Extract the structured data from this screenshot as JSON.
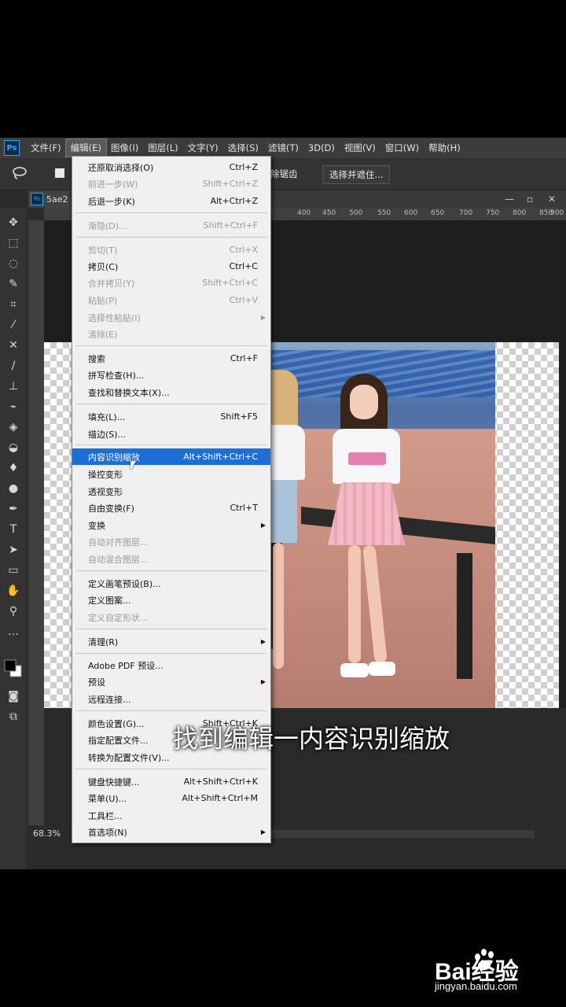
{
  "menubar": {
    "logo": "Ps",
    "items": [
      "文件(F)",
      "编辑(E)",
      "图像(I)",
      "图层(L)",
      "文字(Y)",
      "选择(S)",
      "滤镜(T)",
      "3D(D)",
      "视图(V)",
      "窗口(W)",
      "帮助(H)"
    ]
  },
  "options": {
    "remove_label": "除锯齿",
    "select_mask_label": "选择并遮住..."
  },
  "doc": {
    "tab_label": "5ae2",
    "tab_logo": "Ps",
    "zoom": "68.3%",
    "ruler_ticks": [
      "400",
      "450",
      "500",
      "550",
      "600",
      "650",
      "700",
      "750",
      "800",
      "850",
      "900"
    ]
  },
  "edit_menu": [
    {
      "label": "还原取消选择(O)",
      "shortcut": "Ctrl+Z",
      "disabled": false
    },
    {
      "label": "前进一步(W)",
      "shortcut": "Shift+Ctrl+Z",
      "disabled": true
    },
    {
      "label": "后退一步(K)",
      "shortcut": "Alt+Ctrl+Z",
      "disabled": false
    },
    {
      "label": "渐隐(D)...",
      "shortcut": "Shift+Ctrl+F",
      "disabled": true
    },
    {
      "label": "剪切(T)",
      "shortcut": "Ctrl+X",
      "disabled": true
    },
    {
      "label": "拷贝(C)",
      "shortcut": "Ctrl+C",
      "disabled": false
    },
    {
      "label": "合并拷贝(Y)",
      "shortcut": "Shift+Ctrl+C",
      "disabled": true
    },
    {
      "label": "粘贴(P)",
      "shortcut": "Ctrl+V",
      "disabled": true
    },
    {
      "label": "选择性粘贴(I)",
      "shortcut": "",
      "disabled": true
    },
    {
      "label": "清除(E)",
      "shortcut": "",
      "disabled": true
    },
    {
      "label": "搜索",
      "shortcut": "Ctrl+F",
      "disabled": false
    },
    {
      "label": "拼写检查(H)...",
      "shortcut": "",
      "disabled": false
    },
    {
      "label": "查找和替换文本(X)...",
      "shortcut": "",
      "disabled": false
    },
    {
      "label": "填充(L)...",
      "shortcut": "Shift+F5",
      "disabled": false
    },
    {
      "label": "描边(S)...",
      "shortcut": "",
      "disabled": false
    },
    {
      "label": "内容识别缩放",
      "shortcut": "Alt+Shift+Ctrl+C",
      "disabled": false
    },
    {
      "label": "操控变形",
      "shortcut": "",
      "disabled": false
    },
    {
      "label": "透视变形",
      "shortcut": "",
      "disabled": false
    },
    {
      "label": "自由变换(F)",
      "shortcut": "Ctrl+T",
      "disabled": false
    },
    {
      "label": "变换",
      "shortcut": "",
      "disabled": false
    },
    {
      "label": "自动对齐图层...",
      "shortcut": "",
      "disabled": true
    },
    {
      "label": "自动混合图层...",
      "shortcut": "",
      "disabled": true
    },
    {
      "label": "定义画笔预设(B)...",
      "shortcut": "",
      "disabled": false
    },
    {
      "label": "定义图案...",
      "shortcut": "",
      "disabled": false
    },
    {
      "label": "定义自定形状...",
      "shortcut": "",
      "disabled": true
    },
    {
      "label": "清理(R)",
      "shortcut": "",
      "disabled": false
    },
    {
      "label": "Adobe PDF 预设...",
      "shortcut": "",
      "disabled": false
    },
    {
      "label": "预设",
      "shortcut": "",
      "disabled": false
    },
    {
      "label": "远程连接...",
      "shortcut": "",
      "disabled": false
    },
    {
      "label": "颜色设置(G)...",
      "shortcut": "Shift+Ctrl+K",
      "disabled": false
    },
    {
      "label": "指定配置文件...",
      "shortcut": "",
      "disabled": false
    },
    {
      "label": "转换为配置文件(V)...",
      "shortcut": "",
      "disabled": false
    },
    {
      "label": "键盘快捷键...",
      "shortcut": "Alt+Shift+Ctrl+K",
      "disabled": false
    },
    {
      "label": "菜单(U)...",
      "shortcut": "Alt+Shift+Ctrl+M",
      "disabled": false
    },
    {
      "label": "工具栏...",
      "shortcut": "",
      "disabled": false
    },
    {
      "label": "首选项(N)",
      "shortcut": "",
      "disabled": false
    }
  ],
  "subtitle": "找到编辑一内容识别缩放",
  "watermark": {
    "brand": "Bai经验",
    "site": "jingyan.baidu.com"
  },
  "colors": {
    "highlight": "#1d6fd6",
    "ps_blue": "#31a8ff"
  }
}
